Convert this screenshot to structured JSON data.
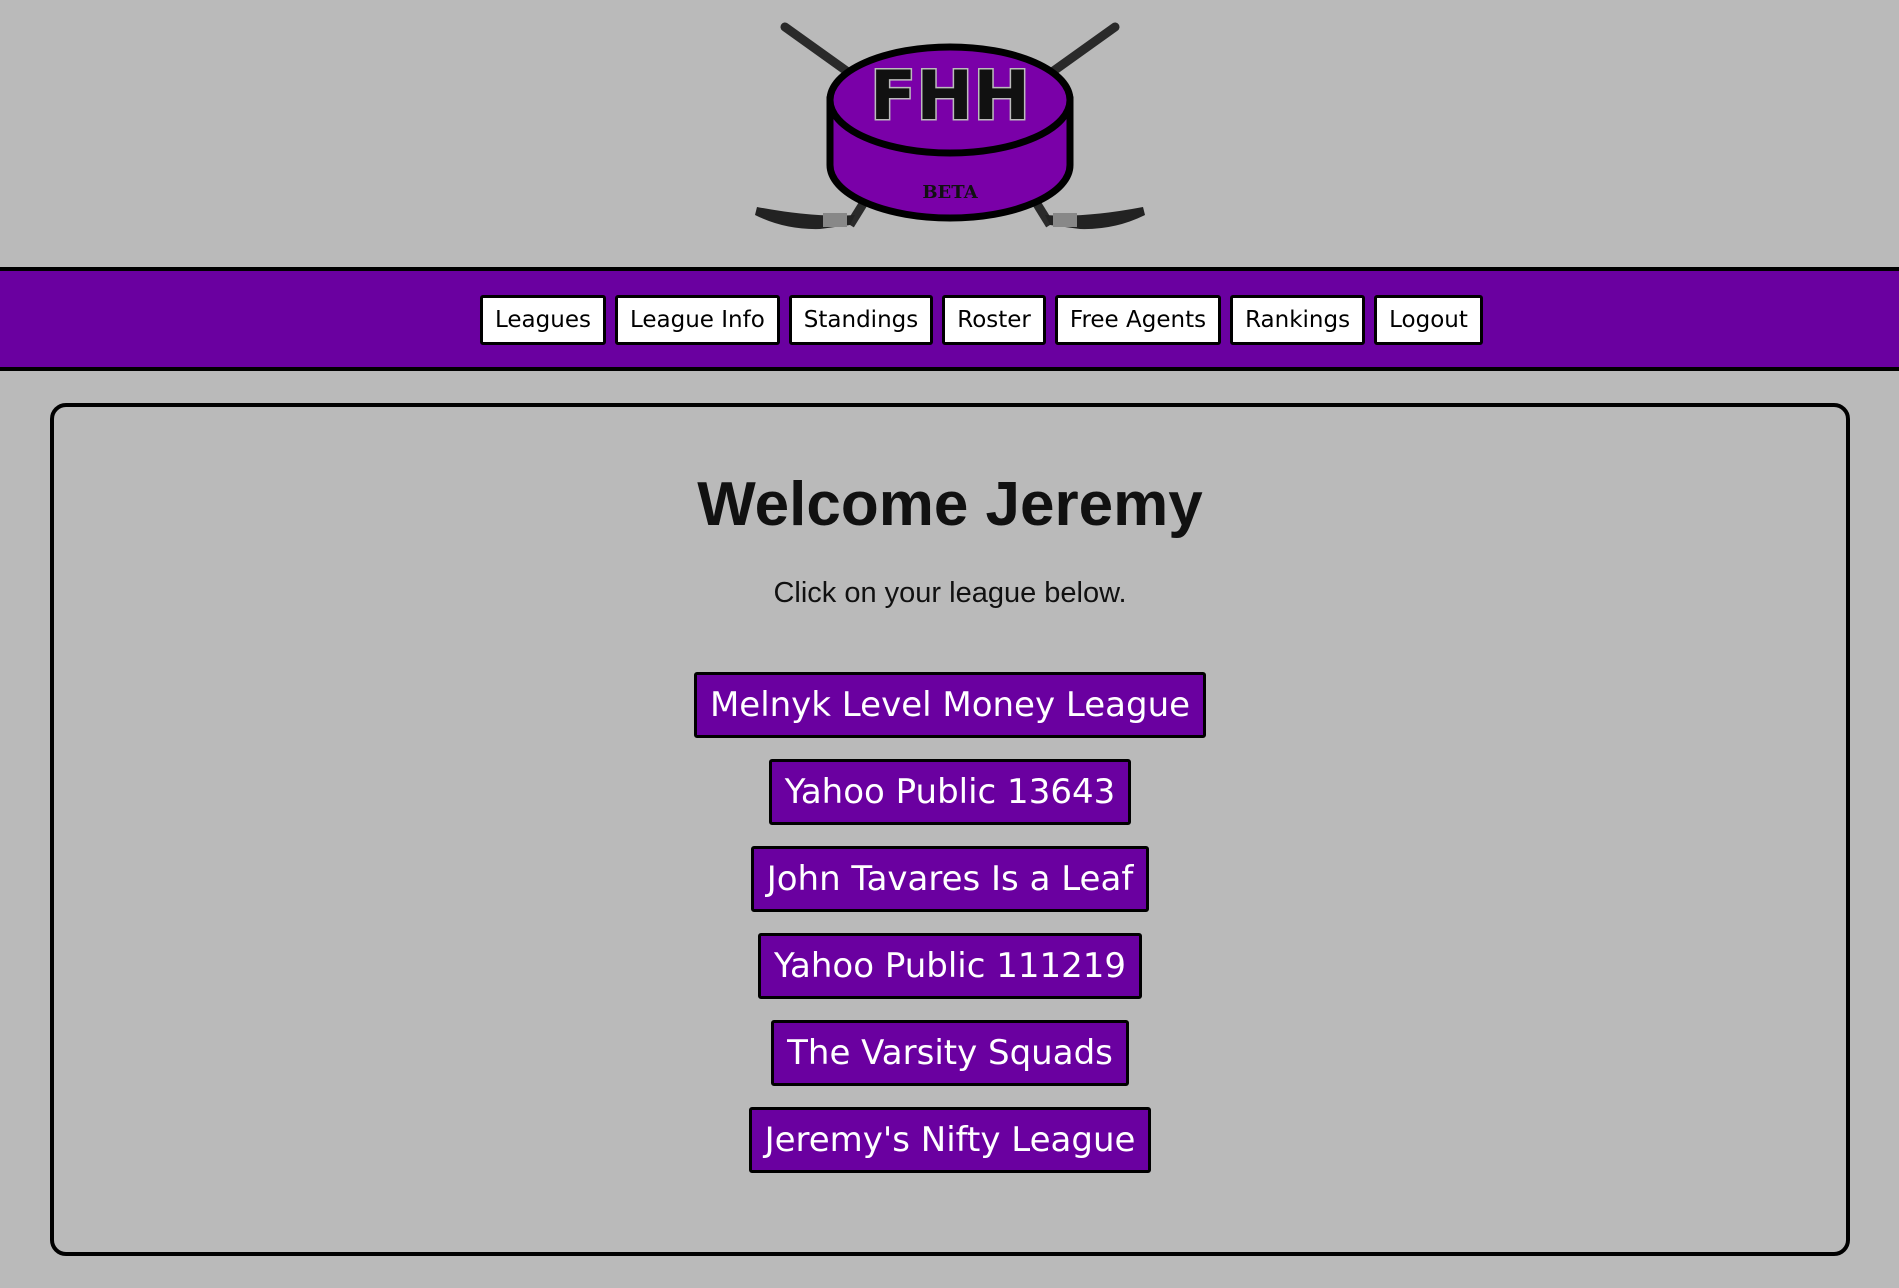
{
  "logo": {
    "initials": "FHH",
    "tag": "BETA"
  },
  "nav": {
    "items": [
      {
        "label": "Leagues"
      },
      {
        "label": "League Info"
      },
      {
        "label": "Standings"
      },
      {
        "label": "Roster"
      },
      {
        "label": "Free Agents"
      },
      {
        "label": "Rankings"
      },
      {
        "label": "Logout"
      }
    ]
  },
  "main": {
    "title": "Welcome Jeremy",
    "instruction": "Click on your league below.",
    "leagues": [
      {
        "label": "Melnyk Level Money League"
      },
      {
        "label": "Yahoo Public 13643"
      },
      {
        "label": "John Tavares Is a Leaf"
      },
      {
        "label": "Yahoo Public 111219"
      },
      {
        "label": "The Varsity Squads"
      },
      {
        "label": "Jeremy's Nifty League"
      }
    ]
  },
  "colors": {
    "background": "#bababa",
    "brand_purple": "#6a00a0",
    "border": "#000000",
    "button_text": "#ffffff"
  }
}
